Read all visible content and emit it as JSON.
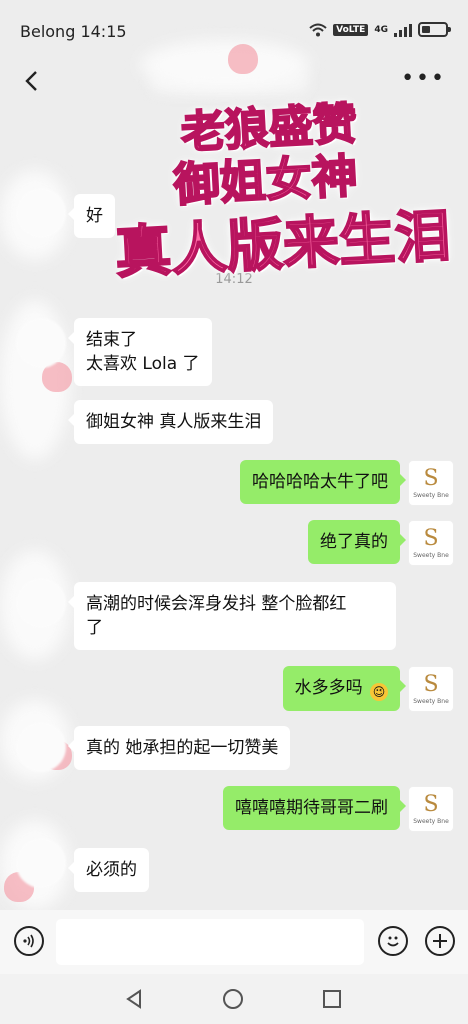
{
  "status_bar": {
    "carrier_time": "Belong 14:15",
    "network": "4G",
    "volte": "VoLTE",
    "battery_level": 0.35
  },
  "nav": {
    "back_icon": "chevron-left-icon",
    "more_icon": "more-dots-icon"
  },
  "promo": {
    "line1": "老狼盛赞",
    "line2": "御姐女神",
    "line3": "真人版来生泪"
  },
  "chat": {
    "timestamp": "14:12",
    "messages": [
      {
        "side": "in",
        "text": "好"
      },
      {
        "side": "in",
        "text_line1": "结束了",
        "text_line2": "太喜欢 Lola 了"
      },
      {
        "side": "in",
        "text": "御姐女神 真人版来生泪"
      },
      {
        "side": "out",
        "text": "哈哈哈哈太牛了吧"
      },
      {
        "side": "out",
        "text": "绝了真的"
      },
      {
        "side": "in",
        "text_line1": "高潮的时候会浑身发抖 整个脸都红",
        "text_line2": "了"
      },
      {
        "side": "out",
        "text": "水多多吗"
      },
      {
        "side": "in",
        "text": "真的 她承担的起一切赞美"
      },
      {
        "side": "out",
        "text": "嘻嘻嘻期待哥哥二刷"
      },
      {
        "side": "in",
        "text": "必须的"
      }
    ],
    "self_avatar": {
      "monogram": "S",
      "brand": "Sweety Bne"
    }
  },
  "input_bar": {
    "voice_icon": "voice-icon",
    "placeholder": "",
    "emoji_icon": "emoji-icon",
    "plus_icon": "plus-icon"
  },
  "system_nav": {
    "back": "triangle-back-icon",
    "home": "circle-home-icon",
    "recents": "square-recents-icon"
  },
  "colors": {
    "background": "#ededed",
    "incoming_bubble": "#ffffff",
    "outgoing_bubble": "#95ec69",
    "promo_pink": "#ff6aa6"
  }
}
